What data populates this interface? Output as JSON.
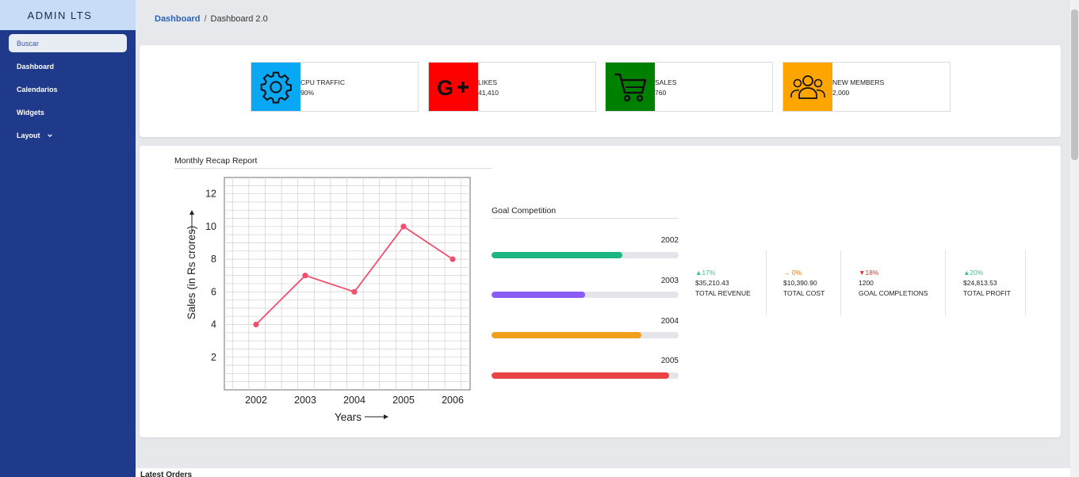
{
  "sidebar": {
    "brand": "ADMIN LTS",
    "search_label": "Buscar",
    "items": [
      {
        "label": "Dashboard"
      },
      {
        "label": "Calendarios"
      },
      {
        "label": "Widgets"
      },
      {
        "label": "Layout"
      }
    ]
  },
  "breadcrumb": {
    "link": "Dashboard",
    "separator": "/",
    "current": "Dashboard 2.0"
  },
  "info_boxes": [
    {
      "label": "CPU TRAFFIC",
      "value": "90%",
      "icon": "gear-icon",
      "color": "#09a8f4"
    },
    {
      "label": "LIKES",
      "value": "41,410",
      "icon": "google-plus-icon",
      "color": "#ff0000"
    },
    {
      "label": "SALES",
      "value": "760",
      "icon": "cart-icon",
      "color": "#008000"
    },
    {
      "label": "NEW MEMBERS",
      "value": "2,000",
      "icon": "users-icon",
      "color": "#ffa500"
    }
  ],
  "recap": {
    "title": "Monthly Recap Report"
  },
  "chart_data": {
    "type": "line",
    "x": [
      "2002",
      "2003",
      "2004",
      "2005",
      "2006"
    ],
    "values": [
      4,
      7,
      6,
      10,
      8
    ],
    "xlabel": "Years",
    "ylabel": "Sales (in Rs crores)",
    "yticks": [
      2,
      4,
      6,
      8,
      10,
      12
    ],
    "ylim": [
      0,
      13
    ],
    "grid": true,
    "line_color": "#f0506e"
  },
  "goal": {
    "title": "Goal Competition",
    "bars": [
      {
        "label": "2002",
        "fraction": 0.7,
        "color": "#1db580"
      },
      {
        "label": "2003",
        "fraction": 0.5,
        "color": "#8b5cf6"
      },
      {
        "label": "2004",
        "fraction": 0.8,
        "color": "#f0a01a"
      },
      {
        "label": "2005",
        "fraction": 0.95,
        "color": "#e84444"
      }
    ]
  },
  "stats": [
    {
      "change": "▲17%",
      "change_color": "#3cc68a",
      "value": "$35,210.43",
      "label": "TOTAL REVENUE"
    },
    {
      "change": "→ 0%",
      "change_color": "#e07b1a",
      "value": "$10,390.90",
      "label": "TOTAL COST"
    },
    {
      "change": "▼18%",
      "change_color": "#e03030",
      "value": "1200",
      "label": "GOAL COMPLETIONS"
    },
    {
      "change": "▲20%",
      "change_color": "#3cc68a",
      "value": "$24,813.53",
      "label": "TOTAL PROFIT"
    }
  ],
  "latest_orders": {
    "title": "Latest Orders"
  }
}
